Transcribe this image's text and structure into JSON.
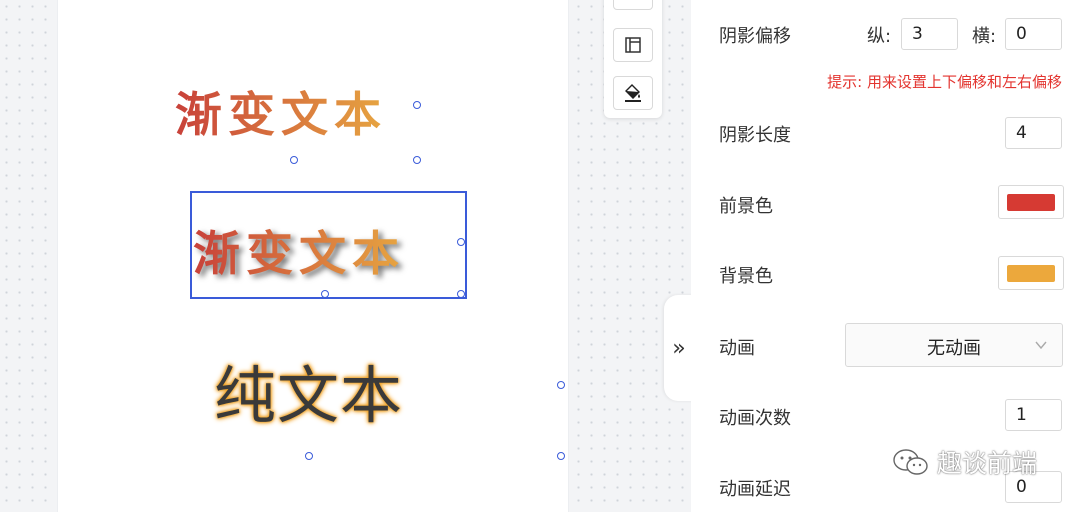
{
  "canvas": {
    "gradient_text_1": "渐变文本",
    "gradient_text_2": "渐变文本",
    "plain_text": "纯文本"
  },
  "toolbar": {
    "icons": [
      "text-icon",
      "layout-icon",
      "fill-color-icon"
    ]
  },
  "panel": {
    "collapse_glyph": "»",
    "shadow_offset": {
      "label": "阴影偏移",
      "vertical_label": "纵:",
      "vertical_value": "3",
      "horizontal_label": "横:",
      "horizontal_value": "0",
      "hint": "提示: 用来设置上下偏移和左右偏移"
    },
    "shadow_length": {
      "label": "阴影长度",
      "value": "4"
    },
    "foreground_color": {
      "label": "前景色",
      "color": "#d63a33"
    },
    "background_color": {
      "label": "背景色",
      "color": "#eca83c"
    },
    "animation": {
      "label": "动画",
      "selected": "无动画"
    },
    "animation_count": {
      "label": "动画次数",
      "value": "1"
    },
    "animation_delay": {
      "label": "动画延迟",
      "value": "0"
    }
  },
  "watermark": {
    "text": "趣谈前端"
  }
}
